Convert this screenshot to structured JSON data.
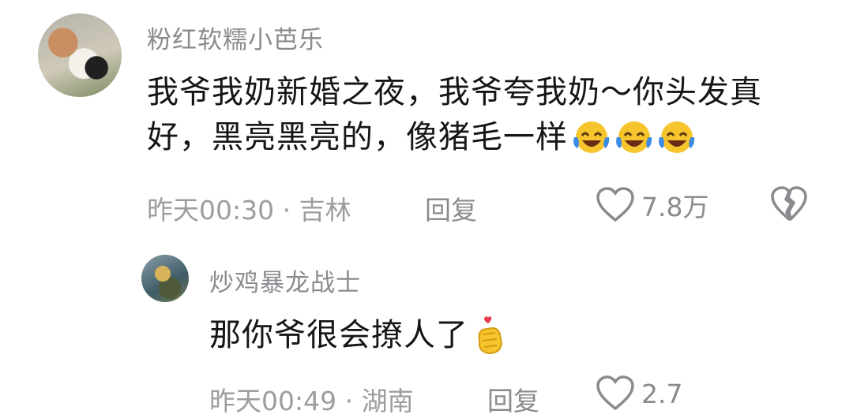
{
  "comment": {
    "username": "粉红软糯小芭乐",
    "text_line1": "我爷我奶新婚之夜，我爷夸我奶～你头发真",
    "text_line2": "好，黑亮黑亮的，像猪毛一样",
    "emoji": [
      "laughing-crying-emoji",
      "laughing-crying-emoji",
      "laughing-crying-emoji"
    ],
    "meta": "昨天00:30 · 吉林",
    "reply_label": "回复",
    "likes": "7.8万"
  },
  "reply": {
    "username": "炒鸡暴龙战士",
    "text": "那你爷很会撩人了",
    "emoji": "finger-heart-emoji",
    "meta": "昨天00:49 · 湖南",
    "reply_label": "回复",
    "likes": "2.7"
  },
  "colors": {
    "text_primary": "#161616",
    "text_secondary": "#8a8a8f",
    "emoji_yellow": "#f6c42c",
    "emoji_blue": "#3b8be5"
  }
}
